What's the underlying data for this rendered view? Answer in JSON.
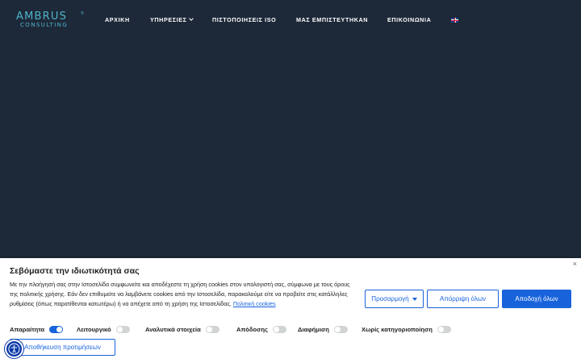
{
  "header": {
    "logo": {
      "main": "AMBRUS",
      "sub": "CONSULTING",
      "reg": "®"
    },
    "nav": [
      {
        "label": "ΑΡΧΙΚΗ"
      },
      {
        "label": "ΥΠΗΡΕΣΙΕΣ"
      },
      {
        "label": "ΠΙΣΤΟΠΟΙΗΣΕΙΣ ISO"
      },
      {
        "label": "ΜΑΣ ΕΜΠΙΣΤΕΥΤΗΚΑΝ"
      },
      {
        "label": "ΕΠΙΚΟΙΝΩΝΙΑ"
      }
    ],
    "language_flag": "uk-flag-icon"
  },
  "cookie_banner": {
    "close_label": "×",
    "title": "Σεβόμαστε την ιδιωτικότητά σας",
    "text": "Με την πλοήγησή σας στην Ιστοσελίδα συμφωνείτε και αποδέχεστε τη χρήση cookies στον υπολογιστή σας, σύμφωνα με τους όρους της πολιτικής χρήσης. Εάν δεν επιθυμείτε να λαμβάνετε cookies από την Ιστοσελίδα, παρακαλούμε είτε να προβείτε στις κατάλληλες ρυθμίσεις (όπως παρατίθενται κατωτέρω) ή να απέχετε από τη χρήση της Ιστοσελίδας.",
    "policy_link": "Πολιτική cookies",
    "buttons": {
      "customize": "Προσαρμογή",
      "reject": "Απόρριψη όλων",
      "accept": "Αποδοχή όλων",
      "save": "Αποθήκευση προτιμήσεων"
    },
    "categories": [
      {
        "label": "Απαραίτητα",
        "enabled": true
      },
      {
        "label": "Λειτουργικό",
        "enabled": false
      },
      {
        "label": "Αναλυτικά στοιχεία",
        "enabled": false
      },
      {
        "label": "Απόδοσης",
        "enabled": false
      },
      {
        "label": "Διαφήμιση",
        "enabled": false
      },
      {
        "label": "Χωρίς κατηγοριοποίηση",
        "enabled": false
      }
    ]
  },
  "accessibility_button": "accessibility-icon",
  "colors": {
    "background": "#1d2939",
    "accent": "#1863dc",
    "logo": "#4fb3c8"
  }
}
